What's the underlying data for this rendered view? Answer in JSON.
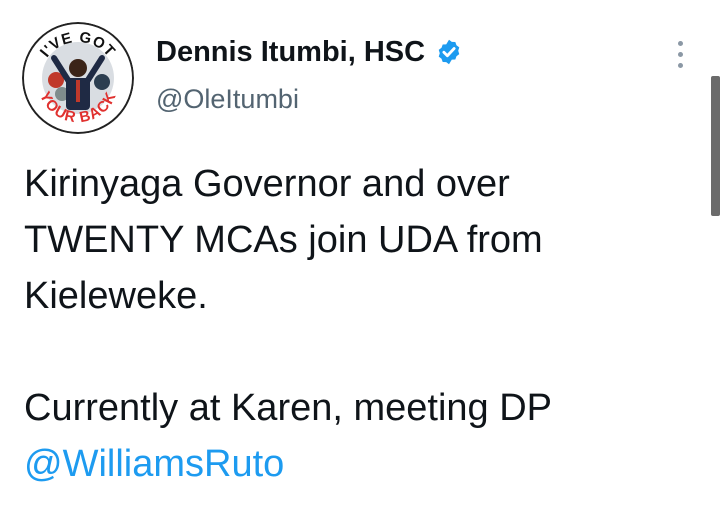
{
  "author": {
    "display_name": "Dennis Itumbi, HSC",
    "handle": "@OleItumbi",
    "verified": true,
    "avatar": {
      "badge_text_top": "I'VE GOT",
      "badge_text_bottom": "YOUR BACK"
    }
  },
  "tweet": {
    "lines": [
      "Kirinyaga Governor and over",
      "TWENTY MCAs join UDA from",
      "Kieleweke.",
      "Currently at Karen, meeting DP"
    ],
    "mention": "@WilliamsRuto"
  },
  "icons": {
    "verified": "verified-badge-icon",
    "more": "more-options-icon"
  },
  "colors": {
    "text": "#0f1419",
    "secondary": "#536471",
    "link": "#1d9bf0",
    "verified": "#1d9bf0",
    "badge_red": "#e0312f"
  }
}
